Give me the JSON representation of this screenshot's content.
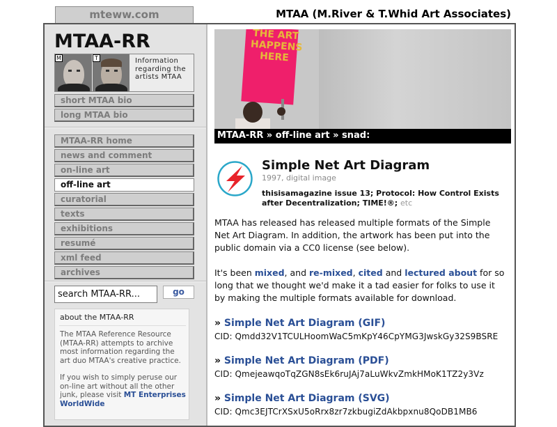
{
  "top": {
    "site_tab": "mteww.com",
    "site_title": "MTAA (M.River & T.Whid Art Associates)"
  },
  "sidebar": {
    "logo": "MTAA-RR",
    "portrait_labels": [
      "M",
      "T"
    ],
    "info_text": "Information regarding the artists MTAA",
    "bio_links": [
      "short MTAA bio",
      "long MTAA bio"
    ],
    "nav": [
      {
        "label": "MTAA-RR home",
        "active": false
      },
      {
        "label": "news and comment",
        "active": false
      },
      {
        "label": "on-line art",
        "active": false
      },
      {
        "label": "off-line art",
        "active": true
      },
      {
        "label": "curatorial",
        "active": false
      },
      {
        "label": "texts",
        "active": false
      },
      {
        "label": "exhibitions",
        "active": false
      },
      {
        "label": "resumé",
        "active": false
      },
      {
        "label": "xml feed",
        "active": false
      },
      {
        "label": "archives",
        "active": false
      }
    ],
    "search": {
      "value": "search MTAA-RR...",
      "go_label": "go"
    },
    "about": {
      "heading": "about the MTAA-RR",
      "p1": "The MTAA Reference Resource (MTAA-RR) attempts to archive most information regarding the art duo MTAA's creative practice.",
      "p2_prefix": "If you wish to simply peruse our on-line art without all the other junk, please visit",
      "p2_link": "MT Enterprises WorldWide"
    }
  },
  "main": {
    "hero_sign_text": "THE ART HAPPENS HERE",
    "breadcrumb": "MTAA-RR » off-line art » snad:",
    "artwork": {
      "title": "Simple Net Art Diagram",
      "meta": "1997, digital image",
      "refs": [
        "thisisamagazine issue 13",
        "Protocol: How Control Exists after Decentralization",
        "TIME!®"
      ],
      "refs_etc": "etc"
    },
    "para1": "MTAA has released has released multiple formats of the Simple Net Art Diagram. In addition, the artwork has been put into the public domain via a CC0 license (see below).",
    "para2": {
      "pre": "It's been",
      "link1": "mixed",
      "mid1": ", and",
      "link2": "re-mixed",
      "mid2": ",",
      "link3": "cited",
      "mid3": "and",
      "link4": "lectured about",
      "post": "for so long that we thought we'd make it a tad easier for folks to use it by making the multiple formats available for download."
    },
    "formats": [
      {
        "label": "Simple Net Art Diagram (GIF)",
        "cid": "CID: Qmdd32V1TCULHoomWaC5mKpY46CpYMG3JwskGy32S9BSRE"
      },
      {
        "label": "Simple Net Art Diagram (PDF)",
        "cid": "CID: QmejeawqoTqZGN8sEk6ruJAj7aLuWkvZmkHMoK1TZ2y3Vz"
      },
      {
        "label": "Simple Net Art Diagram (SVG)",
        "cid": "CID: Qmc3EJTCrXSxU5oRrx8zr7zkbugiZdAkbpxnu8QoDB1MB6"
      }
    ],
    "icon": "lightning-bolt-icon",
    "link_color": "#2a4f96",
    "bolt_color": "#e8232a"
  }
}
